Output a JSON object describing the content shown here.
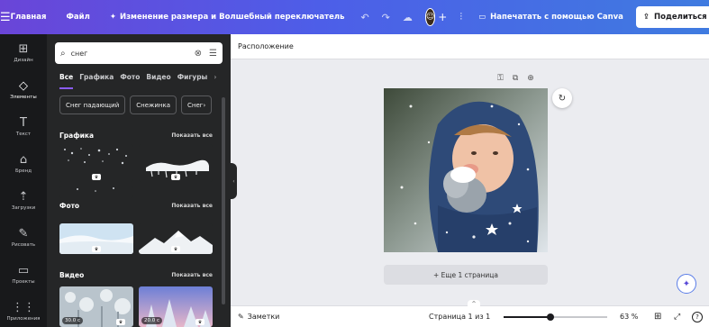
{
  "topbar": {
    "menu_icon": "hamburger-icon",
    "home": "Главная",
    "file": "Файл",
    "resize": "Изменение размера и Волшебный переключатель",
    "print": "Напечатать с помощью Canva",
    "share": "Поделиться"
  },
  "rail": {
    "items": [
      {
        "label": "Дизайн",
        "icon": "layout-icon"
      },
      {
        "label": "Элементы",
        "icon": "elements-icon"
      },
      {
        "label": "Текст",
        "icon": "text-icon"
      },
      {
        "label": "Бренд",
        "icon": "brand-icon"
      },
      {
        "label": "Загрузки",
        "icon": "upload-icon"
      },
      {
        "label": "Рисовать",
        "icon": "draw-icon"
      },
      {
        "label": "Проекты",
        "icon": "folder-icon"
      },
      {
        "label": "Приложения",
        "icon": "apps-icon"
      }
    ]
  },
  "panel": {
    "search": {
      "value": "снег"
    },
    "tabs": [
      "Все",
      "Графика",
      "Фото",
      "Видео",
      "Фигуры"
    ],
    "chips": [
      "Снег падающий",
      "Снежинка",
      "Снег"
    ],
    "sections": {
      "graphics": {
        "title": "Графика",
        "see_all": "Показать все"
      },
      "photos": {
        "title": "Фото",
        "see_all": "Показать все"
      },
      "videos": {
        "title": "Видео",
        "see_all": "Показать все"
      }
    },
    "video_durations": [
      "30.0 с",
      "20.0 с"
    ]
  },
  "editor": {
    "layout_label": "Расположение",
    "add_page": "+ Еще 1 страница",
    "notes": "Заметки",
    "pages": "Страница 1 из 1",
    "zoom": "63 %",
    "zoom_level": 0.45
  },
  "colors": {
    "topbar_start": "#6a45d8",
    "topbar_end": "#3f7be0",
    "rail_bg": "#18191b",
    "panel_bg": "#252627",
    "accent": "#8b5cf6",
    "canvas_bg": "#ebecf0"
  }
}
